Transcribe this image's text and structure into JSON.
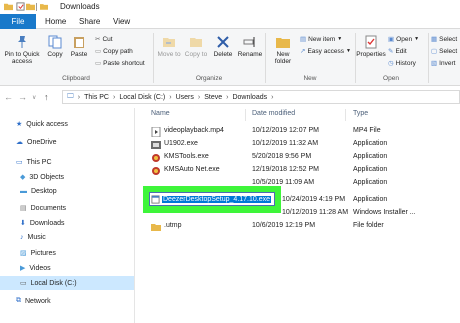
{
  "window": {
    "title": "Downloads"
  },
  "tabs": [
    "File",
    "Home",
    "Share",
    "View"
  ],
  "ribbon": {
    "clipboard": {
      "pin_label": "Pin to Quick access",
      "copy_label": "Copy",
      "paste_label": "Paste",
      "cut_label": "Cut",
      "copy_path_label": "Copy path",
      "paste_shortcut_label": "Paste shortcut",
      "group_label": "Clipboard"
    },
    "organize": {
      "move_to_label": "Move to",
      "copy_to_label": "Copy to",
      "delete_label": "Delete",
      "rename_label": "Rename",
      "group_label": "Organize"
    },
    "new": {
      "new_folder_label": "New folder",
      "new_item_label": "New item",
      "easy_access_label": "Easy access",
      "group_label": "New"
    },
    "open": {
      "properties_label": "Properties",
      "open_label": "Open",
      "edit_label": "Edit",
      "history_label": "History",
      "group_label": "Open"
    },
    "select": {
      "select_all_label": "Select",
      "select_none_label": "Select",
      "invert_label": "Invert"
    }
  },
  "address": {
    "crumbs": [
      "This PC",
      "Local Disk (C:)",
      "Users",
      "Steve",
      "Downloads"
    ]
  },
  "navpane": {
    "items": [
      {
        "label": "Quick access",
        "icon": "star-icon"
      },
      {
        "label": "OneDrive",
        "icon": "cloud-icon"
      },
      {
        "label": "This PC",
        "icon": "computer-icon"
      },
      {
        "label": "3D Objects",
        "icon": "cube-icon"
      },
      {
        "label": "Desktop",
        "icon": "desktop-icon"
      },
      {
        "label": "Documents",
        "icon": "document-icon"
      },
      {
        "label": "Downloads",
        "icon": "download-icon"
      },
      {
        "label": "Music",
        "icon": "music-icon"
      },
      {
        "label": "Pictures",
        "icon": "picture-icon"
      },
      {
        "label": "Videos",
        "icon": "video-icon"
      },
      {
        "label": "Local Disk (C:)",
        "icon": "drive-icon"
      },
      {
        "label": "Network",
        "icon": "network-icon"
      }
    ]
  },
  "filelist": {
    "columns": {
      "name": "Name",
      "date": "Date modified",
      "type": "Type"
    },
    "rows": [
      {
        "name": "videoplayback.mp4",
        "date": "10/12/2019 12:07 PM",
        "type": "MP4 File"
      },
      {
        "name": "U1902.exe",
        "date": "10/12/2019 11:32 AM",
        "type": "Application"
      },
      {
        "name": "KMSTools.exe",
        "date": "5/20/2018 9:56 PM",
        "type": "Application"
      },
      {
        "name": "KMSAuto Net.exe",
        "date": "12/19/2018 12:52 PM",
        "type": "Application"
      },
      {
        "name": "",
        "date": "10/5/2019 11:09 AM",
        "type": "Application"
      },
      {
        "name": "",
        "date": "10/24/2019 4:19 PM",
        "type": "Application"
      },
      {
        "name": "",
        "date": "10/12/2019 11:28 AM",
        "type": "Windows Installer ..."
      },
      {
        "name": ".utmp",
        "date": "10/6/2019 12:19 PM",
        "type": "File folder"
      }
    ],
    "rename_value": "DeezerDesktopSetup_4.17.10.exe"
  },
  "colors": {
    "file_tab": "#1979ca",
    "highlight": "#3ef53a",
    "selection": "#0078d7",
    "nav_selected": "#cce8ff"
  }
}
